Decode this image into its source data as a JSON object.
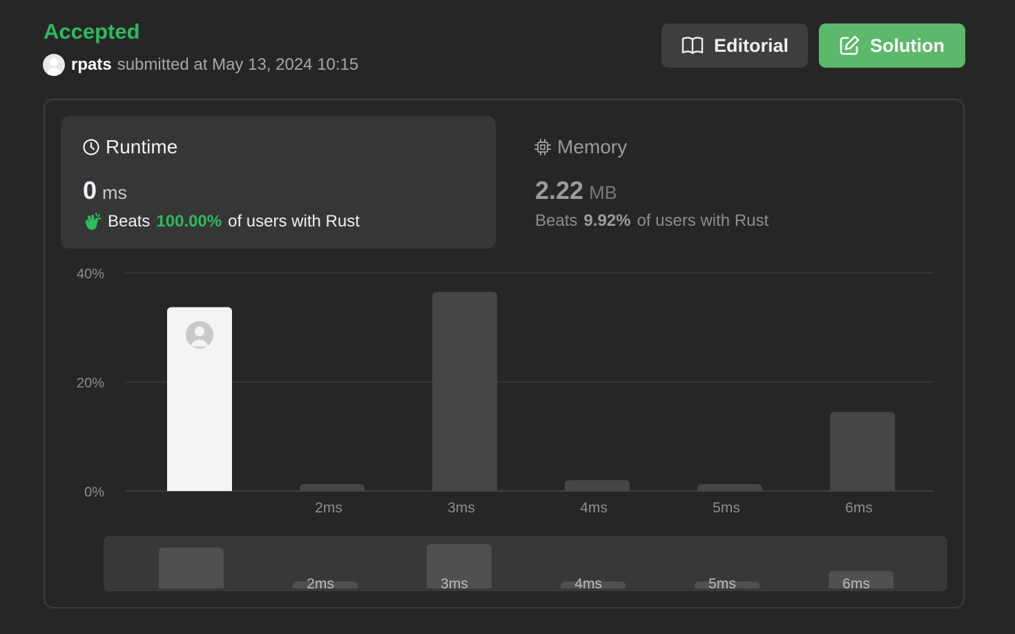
{
  "header": {
    "status": "Accepted",
    "username": "rpats",
    "submitted_text": "submitted at May 13, 2024 10:15",
    "editorial_label": "Editorial",
    "solution_label": "Solution",
    "status_color": "#2cbb5d",
    "solution_color": "#5cb96b"
  },
  "runtime": {
    "title": "Runtime",
    "value": "0",
    "unit": "ms",
    "beats_prefix": "Beats",
    "beats_pct": "100.00%",
    "beats_suffix": "of users with Rust",
    "icon": "clock-icon"
  },
  "memory": {
    "title": "Memory",
    "value": "2.22",
    "unit": "MB",
    "beats_prefix": "Beats",
    "beats_pct": "9.92%",
    "beats_suffix": "of users with Rust",
    "icon": "chip-icon"
  },
  "chart_data": {
    "type": "bar",
    "categories": [
      "",
      "2ms",
      "3ms",
      "4ms",
      "5ms",
      "6ms"
    ],
    "values": [
      33.7,
      1.2,
      36.5,
      2.0,
      1.2,
      14.5
    ],
    "highlight_index": 0,
    "yticks": [
      "40%",
      "20%",
      "0%"
    ],
    "ylim": [
      0,
      40
    ],
    "grid": true,
    "minimap_categories": [
      "",
      "2ms",
      "3ms",
      "4ms",
      "5ms",
      "6ms"
    ]
  }
}
